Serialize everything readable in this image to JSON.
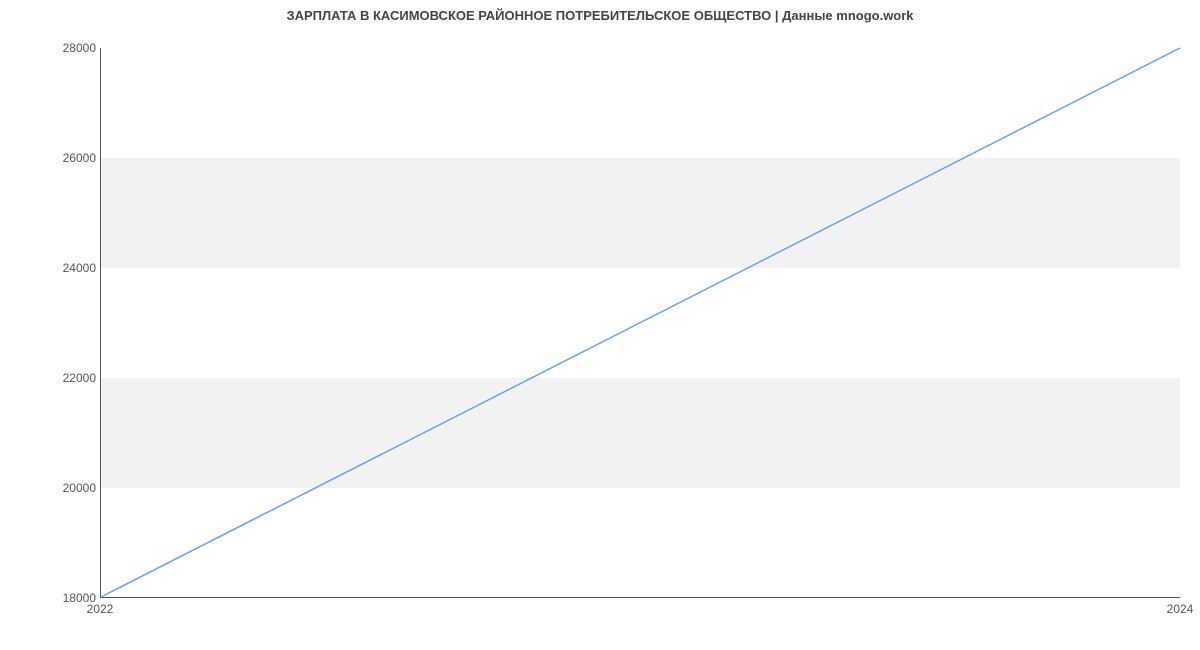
{
  "chart_data": {
    "type": "line",
    "title": "ЗАРПЛАТА В КАСИМОВСКОЕ РАЙОННОЕ ПОТРЕБИТЕЛЬСКОЕ ОБЩЕСТВО | Данные mnogo.work",
    "xlabel": "",
    "ylabel": "",
    "x": [
      2022,
      2024
    ],
    "values": [
      18000,
      28000
    ],
    "xlim": [
      2022,
      2024
    ],
    "ylim": [
      18000,
      28000
    ],
    "x_ticks": [
      2022,
      2024
    ],
    "y_ticks": [
      18000,
      20000,
      22000,
      24000,
      26000,
      28000
    ],
    "line_color": "#6a9ff0",
    "bands": [
      {
        "from": 20000,
        "to": 22000
      },
      {
        "from": 24000,
        "to": 26000
      }
    ]
  }
}
